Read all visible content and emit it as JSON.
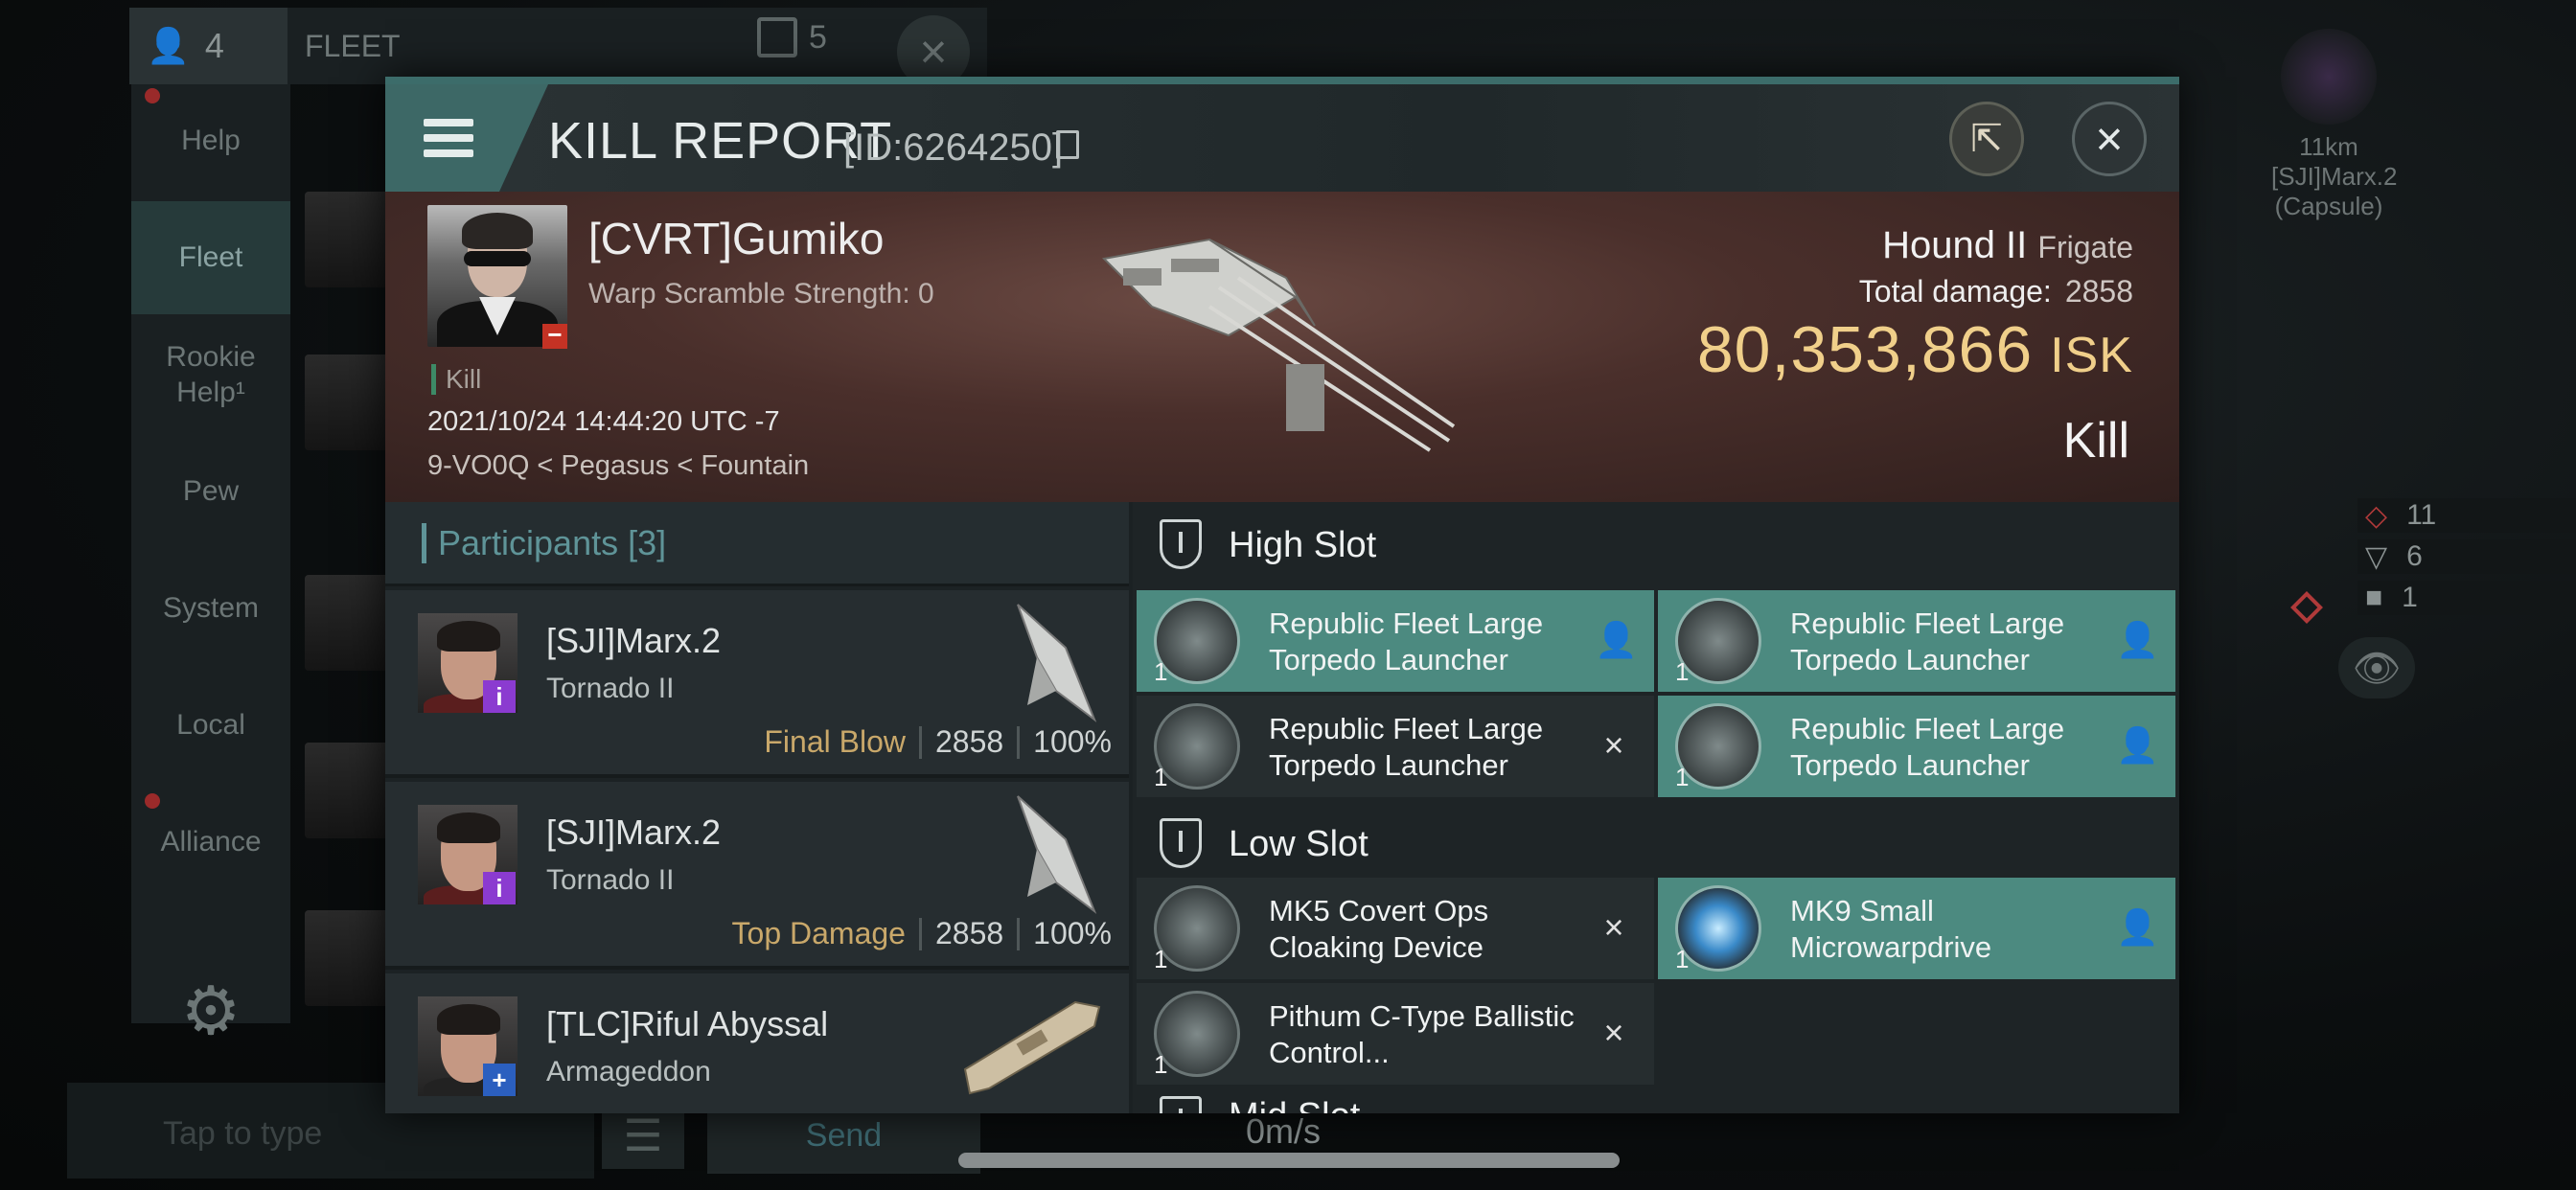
{
  "background": {
    "member_count": "4",
    "fleet_label": "FLEET",
    "squad_count": "5",
    "sidebar": [
      {
        "label": "Help",
        "active": false,
        "dot": true
      },
      {
        "label": "Fleet",
        "active": true,
        "dot": false
      },
      {
        "label": "Rookie\nHelp¹",
        "active": false,
        "dot": false
      },
      {
        "label": "Pew",
        "active": false,
        "dot": false
      },
      {
        "label": "System",
        "active": false,
        "dot": false
      },
      {
        "label": "Local",
        "active": false,
        "dot": false
      },
      {
        "label": "Alliance",
        "active": false,
        "dot": true
      }
    ],
    "chat_placeholder": "Tap to type",
    "send_label": "Send",
    "speed": "0m/s",
    "target": {
      "distance": "11km",
      "name": "[SJI]Marx.2",
      "ship": "(Capsule)"
    },
    "overview_counts": [
      "11",
      "6",
      "1"
    ]
  },
  "modal": {
    "title": "KILL REPORT",
    "report_id": "[ID:6264250]",
    "victim": {
      "name": "[CVRT]Gumiko",
      "warp_scramble": "Warp Scramble Strength: 0",
      "tag": "Kill",
      "datetime": "2021/10/24 14:44:20 UTC -7",
      "location": "9-VO0Q < Pegasus < Fountain"
    },
    "ship": {
      "name": "Hound II",
      "class": "Frigate",
      "total_damage_label": "Total damage:",
      "total_damage": "2858",
      "isk_value": "80,353,866",
      "isk_unit": "ISK",
      "result": "Kill"
    },
    "participants": {
      "header": "Participants",
      "count": "[3]",
      "rows": [
        {
          "name": "[SJI]Marx.2",
          "ship": "Tornado II",
          "label": "Final Blow",
          "damage": "2858",
          "percent": "100%",
          "badge": "i"
        },
        {
          "name": "[SJI]Marx.2",
          "ship": "Tornado II",
          "label": "Top Damage",
          "damage": "2858",
          "percent": "100%",
          "badge": "i"
        },
        {
          "name": "[TLC]Riful Abyssal",
          "ship": "Armageddon",
          "label": "",
          "damage": "",
          "percent": "",
          "badge": "+"
        }
      ]
    },
    "slots": {
      "high_label": "High Slot",
      "low_label": "Low Slot",
      "next_label_partial": "Mid Slot",
      "high": [
        {
          "name": "Republic Fleet Large Torpedo Launcher",
          "qty": "1",
          "status": "dropped"
        },
        {
          "name": "Republic Fleet Large Torpedo Launcher",
          "qty": "1",
          "status": "dropped"
        },
        {
          "name": "Republic Fleet Large Torpedo Launcher",
          "qty": "1",
          "status": "destroyed"
        },
        {
          "name": "Republic Fleet Large Torpedo Launcher",
          "qty": "1",
          "status": "dropped"
        }
      ],
      "low": [
        {
          "name": "MK5 Covert Ops Cloaking Device",
          "qty": "1",
          "status": "destroyed"
        },
        {
          "name": "MK9 Small Microwarpdrive",
          "qty": "1",
          "status": "dropped"
        },
        {
          "name": "Pithum C-Type Ballistic Control...",
          "qty": "1",
          "status": "destroyed"
        }
      ]
    }
  },
  "icons": {
    "person_icon": "person",
    "destroyed_icon": "×",
    "close_icon": "×",
    "share_icon": "share"
  }
}
